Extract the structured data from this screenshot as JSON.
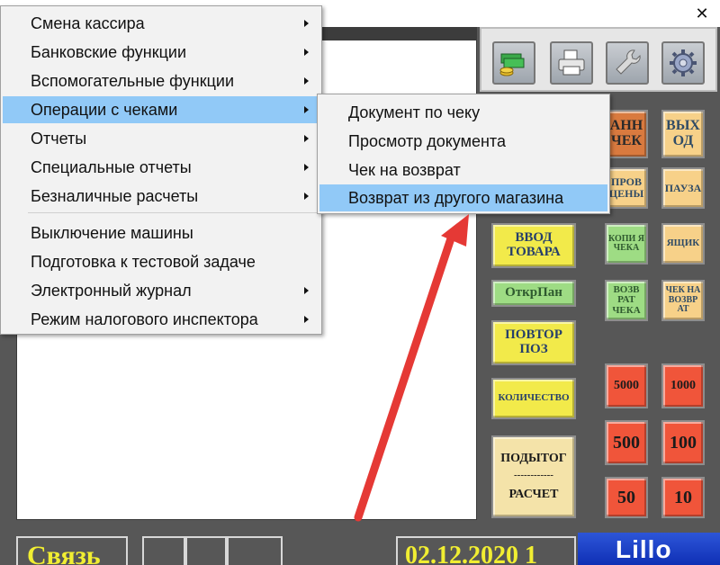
{
  "window": {
    "close_glyph": "✕"
  },
  "main_menu": {
    "items": [
      {
        "label": "Смена кассира",
        "has_submenu": true
      },
      {
        "label": "Банковские функции",
        "has_submenu": true
      },
      {
        "label": "Вспомогательные функции",
        "has_submenu": true
      },
      {
        "label": "Операции с чеками",
        "has_submenu": true,
        "active": true
      },
      {
        "label": "Отчеты",
        "has_submenu": true
      },
      {
        "label": "Специальные отчеты",
        "has_submenu": true
      },
      {
        "label": "Безналичные расчеты",
        "has_submenu": true
      },
      {
        "label": "Выключение машины",
        "has_submenu": false
      },
      {
        "label": "Подготовка к тестовой задаче",
        "has_submenu": false
      },
      {
        "label": "Электронный журнал",
        "has_submenu": true
      },
      {
        "label": "Режим налогового инспектора",
        "has_submenu": true
      }
    ]
  },
  "sub_menu": {
    "items": [
      {
        "label": "Документ по чеку"
      },
      {
        "label": "Просмотр документа"
      },
      {
        "label": "Чек на возврат"
      },
      {
        "label": "Возврат из другого магазина",
        "active": true
      }
    ]
  },
  "toolbar": {
    "icons": [
      "money-icon",
      "printer-icon",
      "wrench-icon",
      "gear-icon"
    ]
  },
  "keys": {
    "annul_check": "АНН ЧЕК",
    "exit": "ВЫХ ОД",
    "price_check": "ПРОВ ЦЕНЫ",
    "pause": "ПАУЗА",
    "enter_goods": "ВВОД ТОВАРА",
    "copy_check": "КОПИ Я ЧЕКА",
    "drawer": "ЯЩИК",
    "open_pan": "ОткрПан",
    "return_check": "ВОЗВ РАТ ЧЕКА",
    "check_return_alt": "ЧЕК НА ВОЗВР АТ",
    "repeat_pos": "ПОВТОР ПОЗ",
    "quantity": "КОЛИЧЕСТВО",
    "subtotal": "ПОДЫТОГ",
    "subtotal_sep": "------------",
    "calc": "РАСЧЕТ",
    "k5000": "5000",
    "k1000": "1000",
    "k500": "500",
    "k100": "100",
    "k50": "50",
    "k10": "10"
  },
  "status": {
    "link": "Связь",
    "date": "02.12.2020 1",
    "logo": "Lillo"
  },
  "colors": {
    "menu_highlight": "#91c9f7",
    "arrow": "#e53935",
    "status_text": "#f1ee32",
    "background": "#575757"
  }
}
